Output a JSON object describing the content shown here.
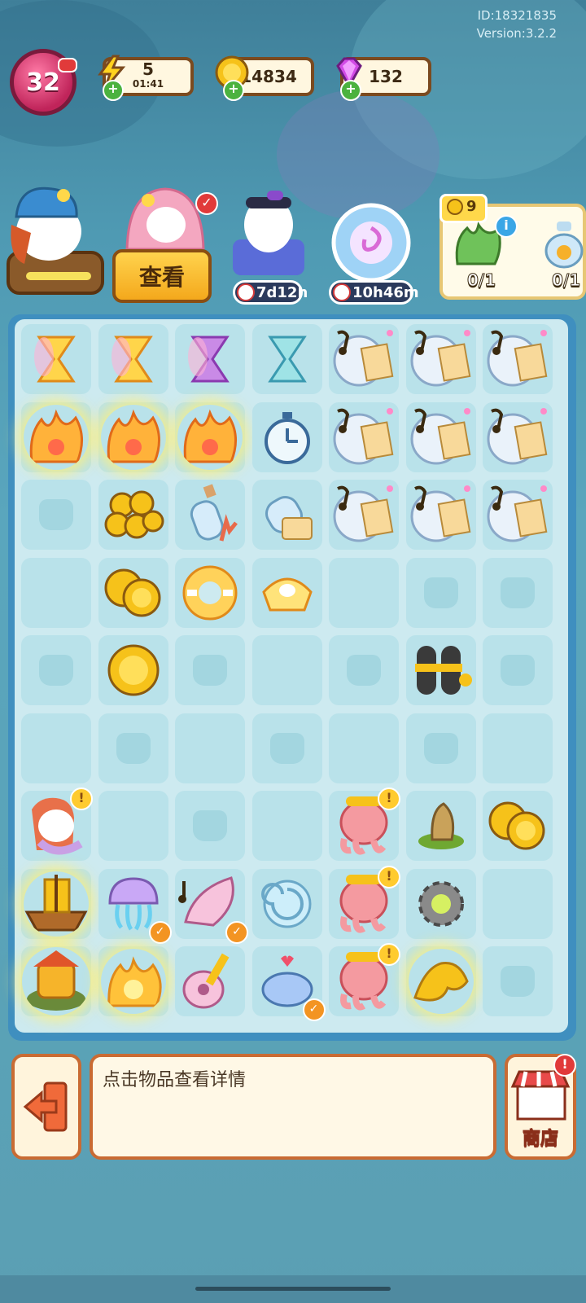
{
  "game": {
    "id_text": "ID:18321835",
    "version_text": "Version:3.2.2",
    "player_level": "32",
    "energy": {
      "value": "5",
      "timer": "01:41",
      "icon": "lightning-icon"
    },
    "coins": {
      "value": "14834",
      "icon": "coin-icon"
    },
    "gems": {
      "value": "132",
      "icon": "gem-icon"
    },
    "accent_color": "#ffd34d"
  },
  "characters": {
    "view_button": "查看",
    "event_timer_1": "7d12h",
    "event_timer_2": "10h46m"
  },
  "quest": {
    "badge": "9",
    "progress_1": "0/1",
    "progress_2": "0/1"
  },
  "board": {
    "cells": [
      [
        "hourglass-gold",
        "hourglass-gold",
        "hourglass-purple",
        "hourglass-blue",
        "music-bottle",
        "music-bottle",
        "music-bottle"
      ],
      [
        "coral-generator",
        "coral-generator",
        "coral-generator",
        "stopwatch",
        "music-bottle",
        "music-bottle",
        "music-bottle"
      ],
      [
        "locked",
        "coin-pile",
        "message-bottle-coral",
        "message-bottle-scroll",
        "music-bottle",
        "music-bottle",
        "music-bottle"
      ],
      [
        "empty",
        "coin-stack",
        "swim-ring",
        "shell-cap",
        "empty",
        "locked",
        "locked"
      ],
      [
        "locked",
        "coin",
        "locked",
        "empty",
        "locked",
        "scuba-tank",
        "locked"
      ],
      [
        "empty",
        "locked",
        "empty",
        "locked",
        "empty",
        "locked",
        "empty"
      ],
      [
        "mermaid",
        "empty",
        "locked",
        "empty",
        "octopus",
        "sea-shell-sprout",
        "coin-stack"
      ],
      [
        "treasure-ship",
        "jellyfish",
        "conch-music",
        "snail-shell",
        "octopus",
        "gear",
        "empty"
      ],
      [
        "turtle-house",
        "sun-coral",
        "guitar-shell",
        "fish-heart",
        "octopus",
        "golden-dragon",
        "locked"
      ]
    ]
  },
  "bottom": {
    "info_text": "点击物品查看详情",
    "shop_label": "商店"
  }
}
